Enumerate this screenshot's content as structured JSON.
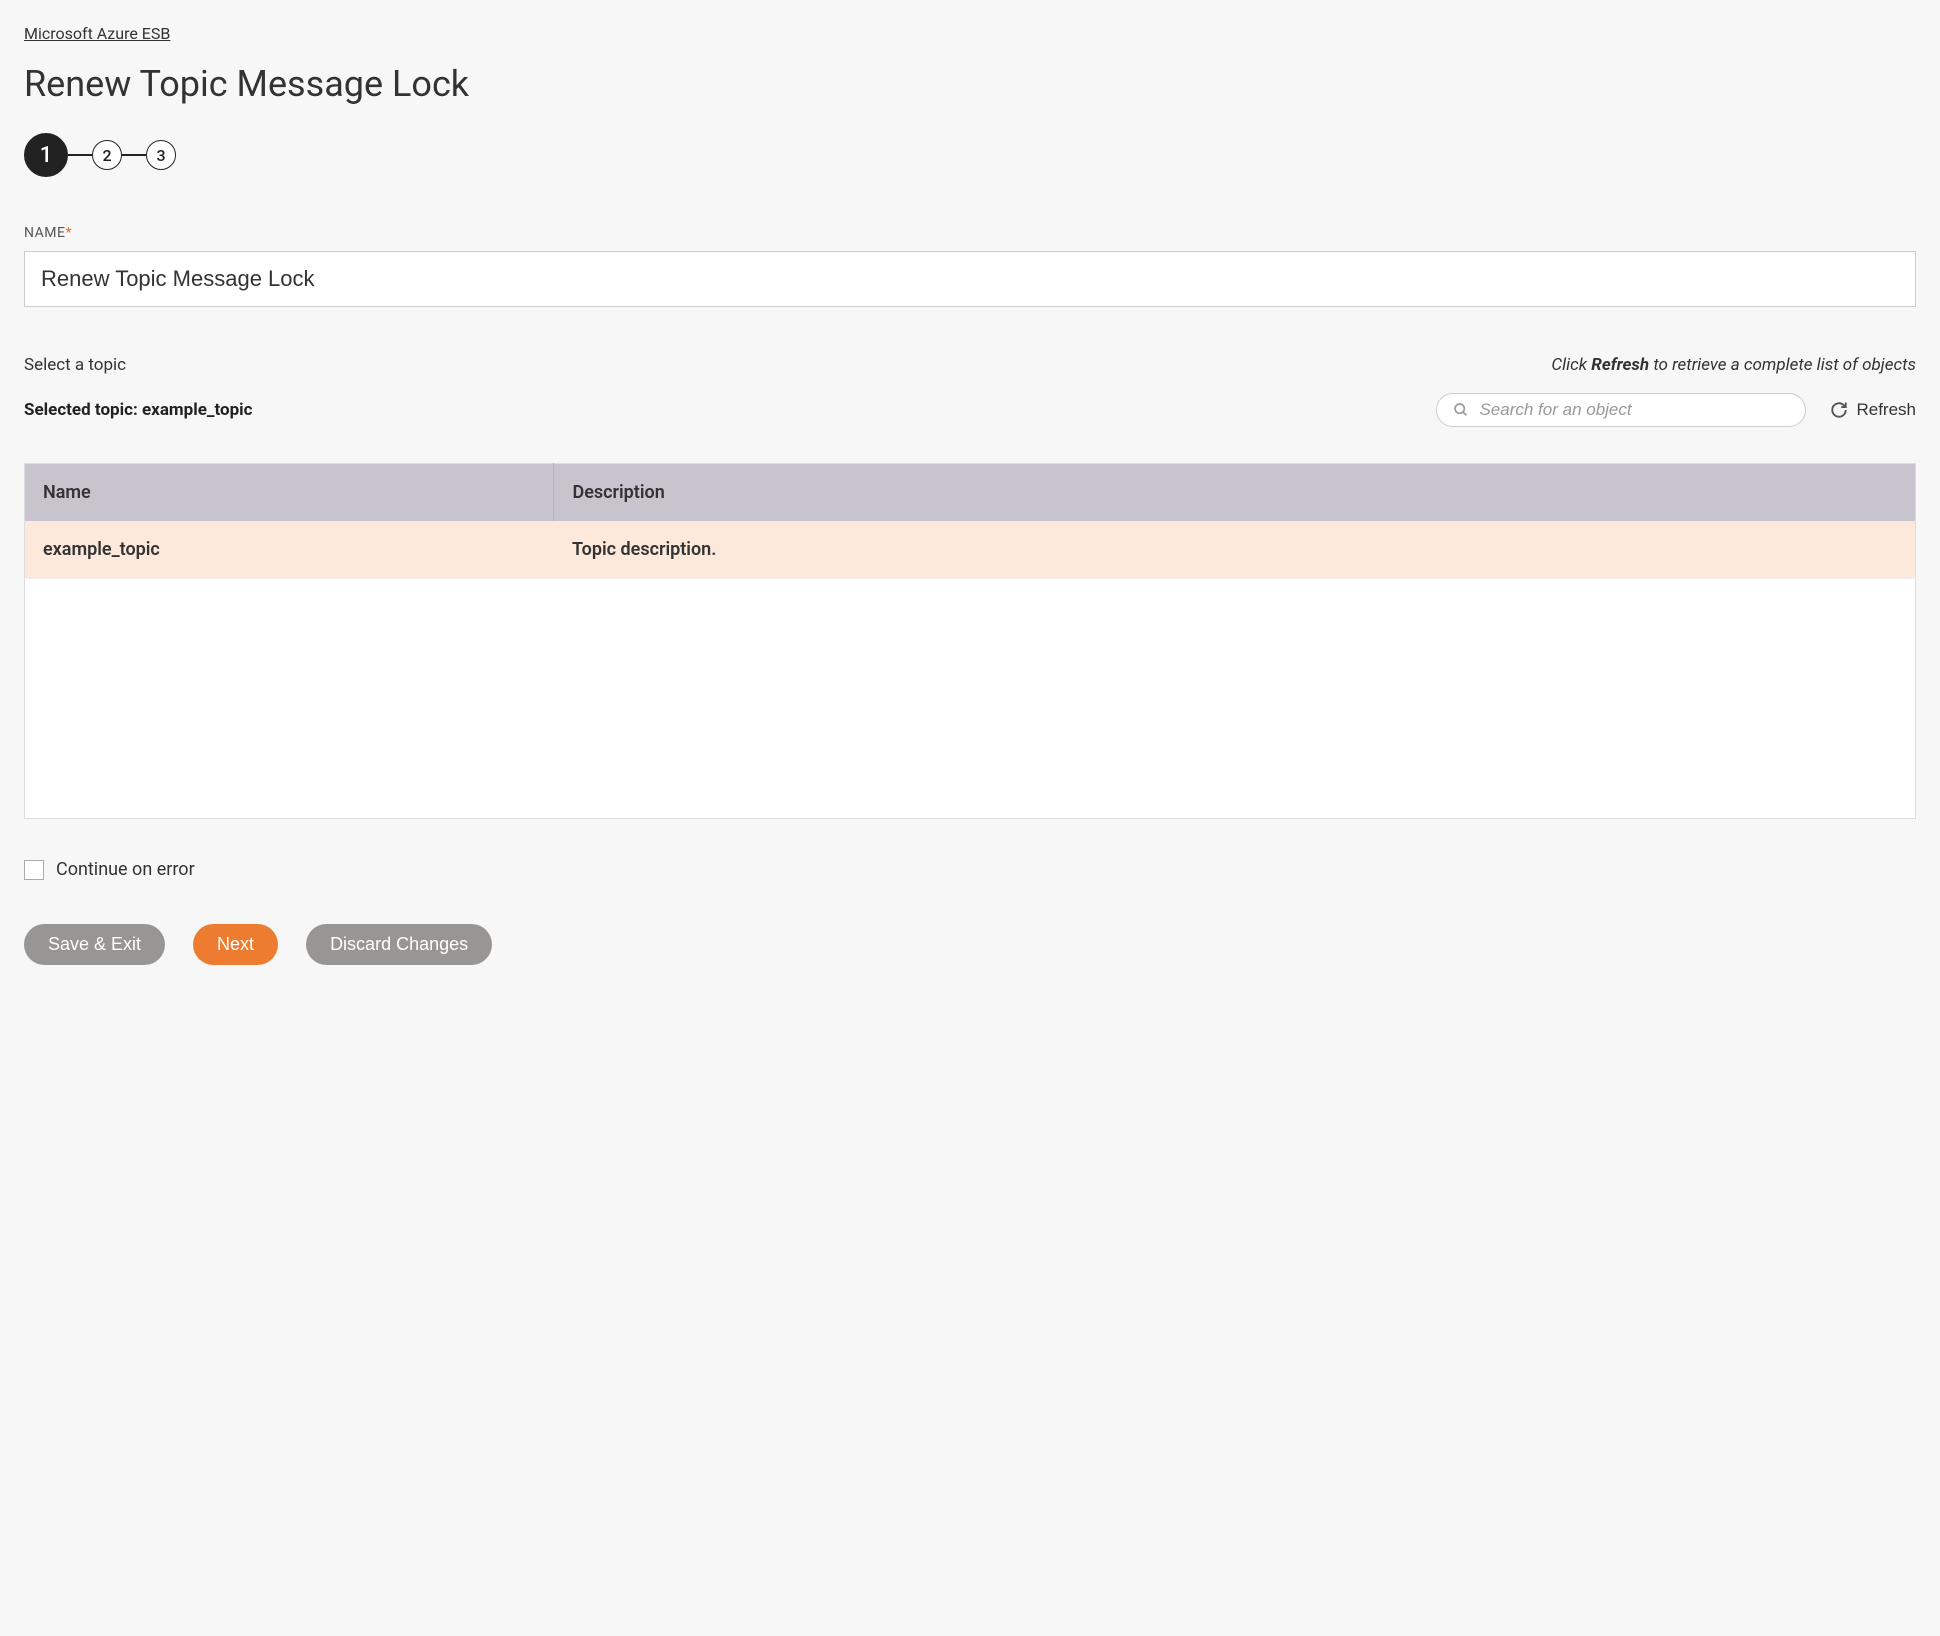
{
  "breadcrumb": "Microsoft Azure ESB",
  "pageTitle": "Renew Topic Message Lock",
  "stepper": {
    "steps": [
      "1",
      "2",
      "3"
    ],
    "active": 0
  },
  "form": {
    "nameLabel": "NAME",
    "nameValue": "Renew Topic Message Lock"
  },
  "topicSection": {
    "selectLabel": "Select a topic",
    "refreshHintPrefix": "Click ",
    "refreshHintBold": "Refresh",
    "refreshHintSuffix": " to retrieve a complete list of objects",
    "selectedPrefix": "Selected topic: ",
    "selectedValue": "example_topic",
    "searchPlaceholder": "Search for an object",
    "refreshButton": "Refresh"
  },
  "table": {
    "headers": {
      "name": "Name",
      "description": "Description"
    },
    "rows": [
      {
        "name": "example_topic",
        "description": "Topic description."
      }
    ]
  },
  "continueOnError": {
    "label": "Continue on error",
    "checked": false
  },
  "buttons": {
    "saveExit": "Save & Exit",
    "next": "Next",
    "discard": "Discard Changes"
  }
}
